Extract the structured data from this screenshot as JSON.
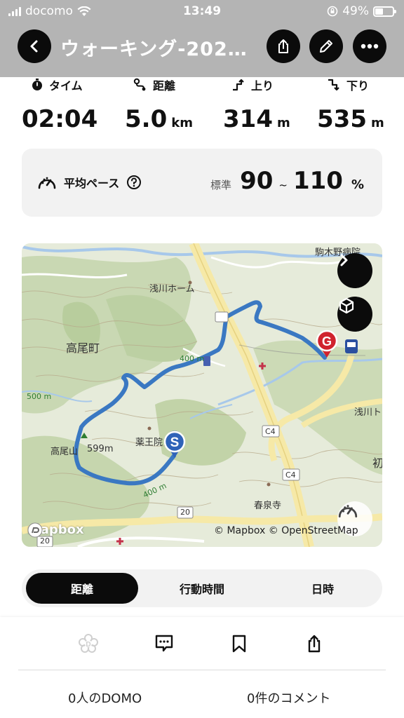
{
  "status_bar": {
    "carrier": "docomo",
    "time": "13:49",
    "battery": "49%"
  },
  "nav": {
    "title": "ウォーキング-202…",
    "icons": [
      "back-icon",
      "share-icon",
      "edit-pencil-icon",
      "more-icon"
    ]
  },
  "stats": [
    {
      "icon": "stopwatch-icon",
      "label": "タイム",
      "value": "02:04",
      "unit": ""
    },
    {
      "icon": "route-icon",
      "label": "距離",
      "value": "5.0",
      "unit": "km"
    },
    {
      "icon": "ascent-icon",
      "label": "上り",
      "value": "314",
      "unit": "m"
    },
    {
      "icon": "descent-icon",
      "label": "下り",
      "value": "535",
      "unit": "m"
    }
  ],
  "pace": {
    "label": "平均ペース",
    "standard_label": "標準",
    "min": "90",
    "tilde": "~",
    "max": "110",
    "unit": "%"
  },
  "map": {
    "labels": {
      "komagino": "駒木野病院",
      "asakawa_home": "浅川ホーム",
      "takao_town": "高尾町",
      "elev_400_top": "400 m",
      "elev_500": "500 m",
      "takao_peak": "高尾山",
      "peak_height": "599m",
      "yakuoin": "薬王院",
      "road_c4_a": "C4",
      "road_c4_b": "C4",
      "asakawa_right": "浅川ト",
      "hatsu": "初",
      "elev_400_bottom": "400 m",
      "shunsen": "春泉寺",
      "road_20_a": "20",
      "road_20_b": "20"
    },
    "mapbox_logo": "mapbox",
    "attribution": "© Mapbox  © OpenStreetMap"
  },
  "segments": {
    "items": [
      "距離",
      "行動時間",
      "日時"
    ],
    "active": "距離"
  },
  "bottom": {
    "domo_count": "0人のDOMO",
    "comment_count": "0件のコメント"
  },
  "colors": {
    "route": "#3a78c2",
    "start_marker": "#2f63b8",
    "goal_marker": "#d0232e",
    "header_bg": "#b4b4b4"
  }
}
